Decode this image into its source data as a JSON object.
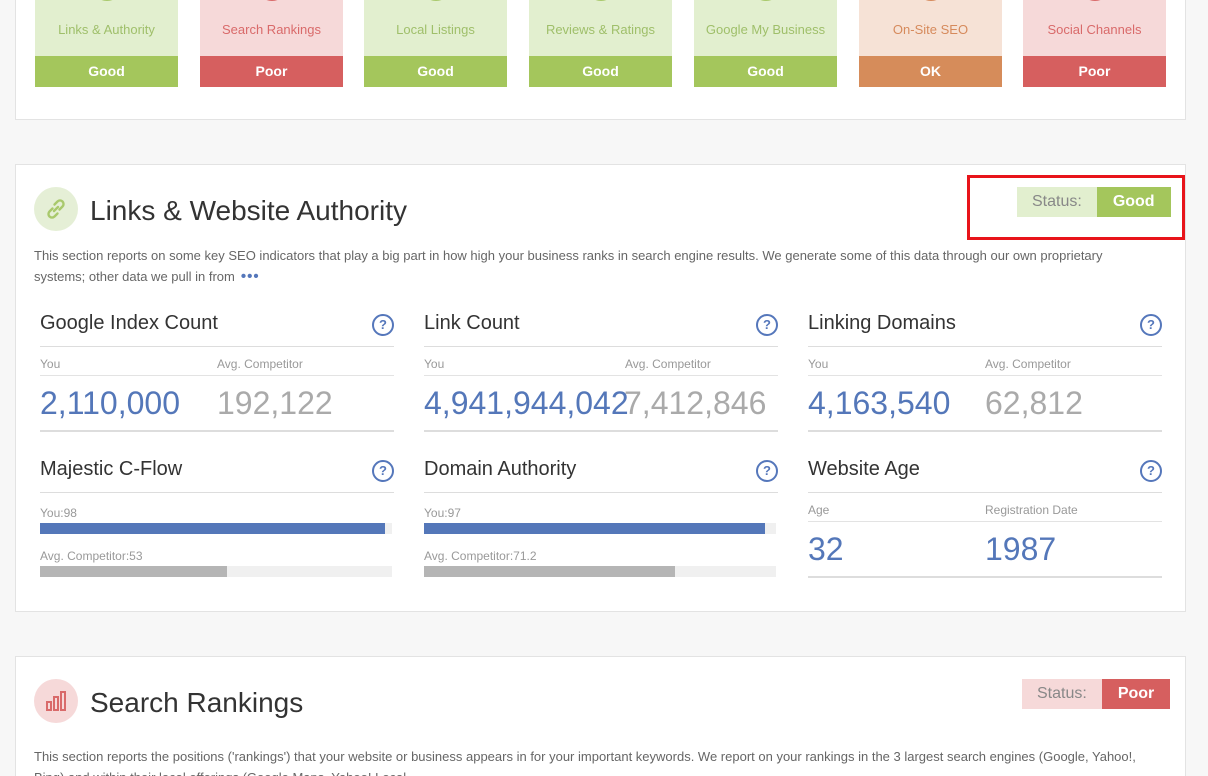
{
  "summary_tiles": [
    {
      "label": "Links & Authority",
      "status": "Good",
      "tone": "good"
    },
    {
      "label": "Search Rankings",
      "status": "Poor",
      "tone": "poor"
    },
    {
      "label": "Local Listings",
      "status": "Good",
      "tone": "good"
    },
    {
      "label": "Reviews & Ratings",
      "status": "Good",
      "tone": "good"
    },
    {
      "label": "Google My Business",
      "status": "Good",
      "tone": "good"
    },
    {
      "label": "On-Site SEO",
      "status": "OK",
      "tone": "ok"
    },
    {
      "label": "Social Channels",
      "status": "Poor",
      "tone": "poor"
    }
  ],
  "links_section": {
    "title": "Links & Website Authority",
    "status_label": "Status:",
    "status_value": "Good",
    "description": "This section reports on some key SEO indicators that play a big part in how high your business ranks in search engine results. We generate some of this data through our own proprietary systems; other data we pull in from",
    "more": "•••",
    "help": "?",
    "google_index": {
      "title": "Google Index Count",
      "you_label": "You",
      "comp_label": "Avg. Competitor",
      "you": "2,110,000",
      "comp": "192,122"
    },
    "link_count": {
      "title": "Link Count",
      "you_label": "You",
      "comp_label": "Avg. Competitor",
      "you": "4,941,944,042",
      "comp": "7,412,846"
    },
    "linking_domains": {
      "title": "Linking Domains",
      "you_label": "You",
      "comp_label": "Avg. Competitor",
      "you": "4,163,540",
      "comp": "62,812"
    },
    "majestic": {
      "title": "Majestic C-Flow",
      "you_label": "You:98",
      "comp_label": "Avg. Competitor:53",
      "you_value": 98,
      "comp_value": 53
    },
    "domain_authority": {
      "title": "Domain Authority",
      "you_label": "You:97",
      "comp_label": "Avg. Competitor:71.2",
      "you_value": 97,
      "comp_value": 71.2
    },
    "website_age": {
      "title": "Website Age",
      "age_label": "Age",
      "reg_label": "Registration Date",
      "age": "32",
      "reg": "1987"
    }
  },
  "rankings_section": {
    "title": "Search Rankings",
    "status_label": "Status:",
    "status_value": "Poor",
    "description": "This section reports the positions ('rankings') that your website or business appears in for your important keywords. We report on your rankings in the 3 largest search engines (Google, Yahoo!, Bing) and within their local offerings (Google Maps, Yahoo! Local"
  },
  "colors": {
    "good": "#a4c65c",
    "poor": "#d65f5f",
    "ok": "#d68c5a",
    "accent_blue": "#5477b9"
  }
}
